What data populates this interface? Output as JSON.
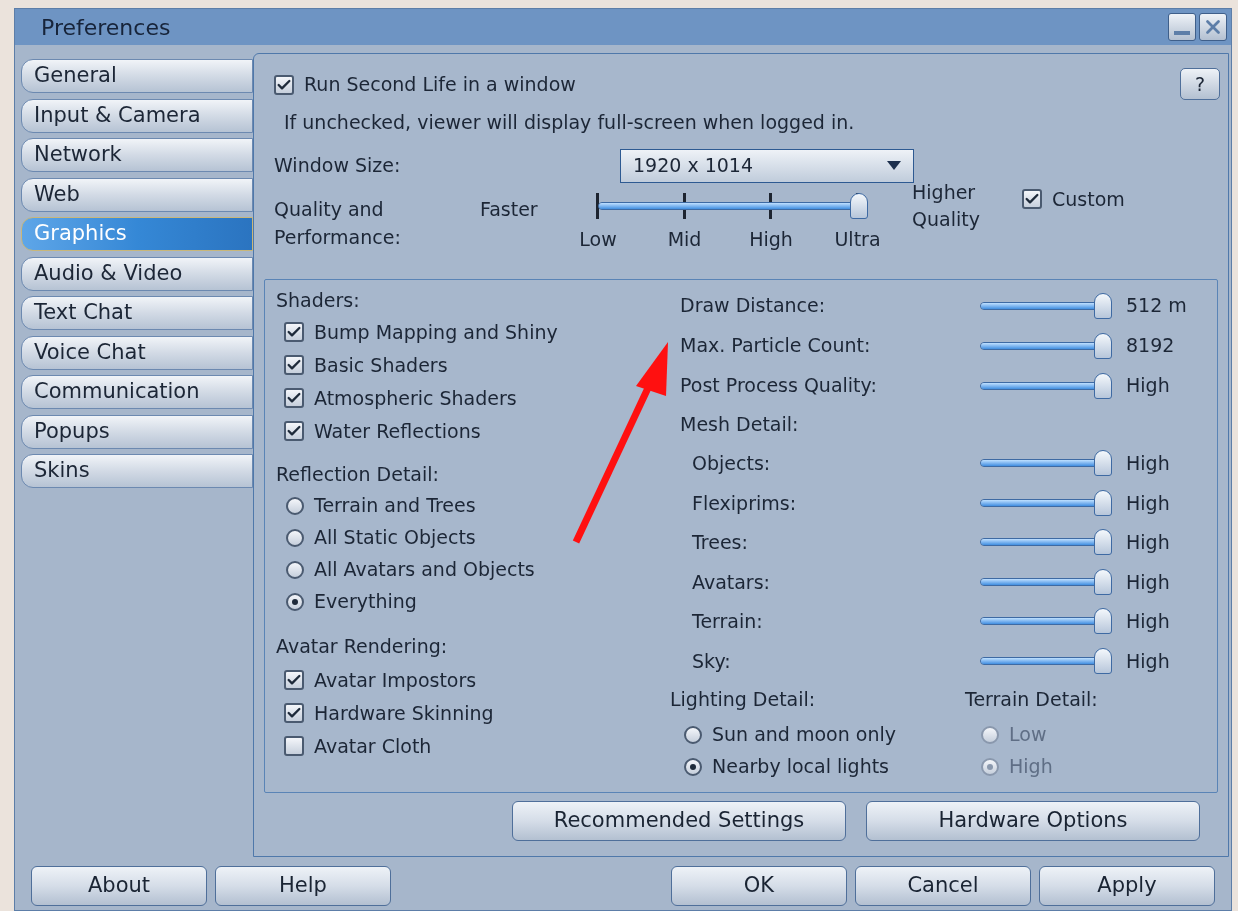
{
  "window": {
    "title": "Preferences"
  },
  "sidebar": {
    "tabs": [
      {
        "label": "General",
        "selected": false
      },
      {
        "label": "Input & Camera",
        "selected": false
      },
      {
        "label": "Network",
        "selected": false
      },
      {
        "label": "Web",
        "selected": false
      },
      {
        "label": "Graphics",
        "selected": true
      },
      {
        "label": "Audio & Video",
        "selected": false
      },
      {
        "label": "Text Chat",
        "selected": false
      },
      {
        "label": "Voice Chat",
        "selected": false
      },
      {
        "label": "Communication",
        "selected": false
      },
      {
        "label": "Popups",
        "selected": false
      },
      {
        "label": "Skins",
        "selected": false
      }
    ]
  },
  "run_in_window": {
    "label": "Run Second Life in a window",
    "checked": true
  },
  "help_button": "?",
  "hint": "If unchecked, viewer will display full-screen when logged in.",
  "window_size": {
    "label": "Window Size:",
    "value": "1920 x 1014"
  },
  "quality": {
    "label": "Quality and Performance:",
    "left_label": "Faster",
    "right_label": "Higher Quality",
    "level": 1,
    "ticks": [
      "Low",
      "Mid",
      "High",
      "Ultra"
    ]
  },
  "custom": {
    "label": "Custom",
    "checked": true
  },
  "shaders": {
    "title": "Shaders:",
    "items": [
      {
        "label": "Bump Mapping and Shiny",
        "checked": true
      },
      {
        "label": "Basic Shaders",
        "checked": true
      },
      {
        "label": "Atmospheric Shaders",
        "checked": true
      },
      {
        "label": "Water Reflections",
        "checked": true
      }
    ]
  },
  "reflection_detail": {
    "title": "Reflection Detail:",
    "options": [
      {
        "label": "Terrain and Trees",
        "selected": false
      },
      {
        "label": "All Static Objects",
        "selected": false
      },
      {
        "label": "All Avatars and Objects",
        "selected": false
      },
      {
        "label": "Everything",
        "selected": true
      }
    ]
  },
  "avatar_rendering": {
    "title": "Avatar Rendering:",
    "items": [
      {
        "label": "Avatar Impostors",
        "checked": true
      },
      {
        "label": "Hardware Skinning",
        "checked": true
      },
      {
        "label": "Avatar Cloth",
        "checked": false
      }
    ]
  },
  "detail_sliders": [
    {
      "label": "Draw Distance:",
      "level": 1,
      "reading": "512 m"
    },
    {
      "label": "Max. Particle Count:",
      "level": 1,
      "reading": "8192"
    },
    {
      "label": "Post Process Quality:",
      "level": 1,
      "reading": "High"
    }
  ],
  "mesh_detail": {
    "title": "Mesh Detail:",
    "sliders": [
      {
        "label": "Objects:",
        "level": 1,
        "reading": "High"
      },
      {
        "label": "Flexiprims:",
        "level": 1,
        "reading": "High"
      },
      {
        "label": "Trees:",
        "level": 1,
        "reading": "High"
      },
      {
        "label": "Avatars:",
        "level": 1,
        "reading": "High"
      },
      {
        "label": "Terrain:",
        "level": 1,
        "reading": "High"
      },
      {
        "label": "Sky:",
        "level": 1,
        "reading": "High"
      }
    ]
  },
  "lighting_detail": {
    "title": "Lighting Detail:",
    "options": [
      {
        "label": "Sun and moon only",
        "selected": false
      },
      {
        "label": "Nearby local lights",
        "selected": true
      }
    ]
  },
  "terrain_detail": {
    "title": "Terrain Detail:",
    "disabled": true,
    "options": [
      {
        "label": "Low",
        "selected": false
      },
      {
        "label": "High",
        "selected": true
      }
    ]
  },
  "panel_buttons": [
    "Recommended Settings",
    "Hardware Options"
  ],
  "footer_left_buttons": [
    "About",
    "Help"
  ],
  "footer_right_buttons": [
    "OK",
    "Cancel",
    "Apply"
  ]
}
